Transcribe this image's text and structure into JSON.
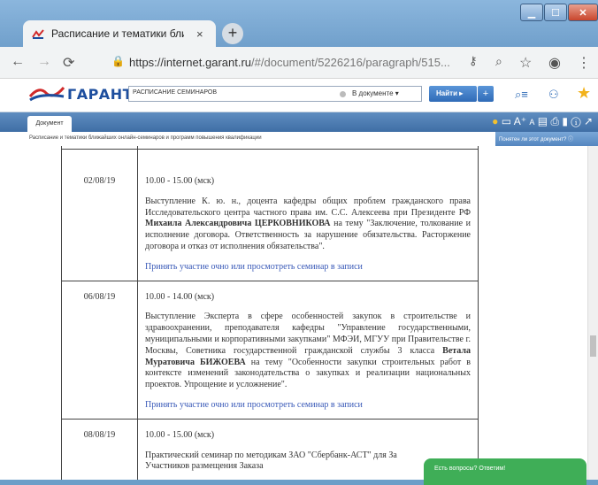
{
  "browser": {
    "tab_title": "Расписание и тематики ближай",
    "tab_close": "×",
    "new_tab": "+",
    "url_host": "https://internet.garant.ru",
    "url_path": "/#/document/5226216/paragraph/515...",
    "window_minimize": "▁",
    "window_maximize": "☐",
    "window_close": "✕"
  },
  "garant": {
    "logo_text": "ГАРАНТ",
    "search_value": "РАСПИСАНИЕ СЕМИНАРОВ",
    "scope": "В документе",
    "find_label": "Найти",
    "plus_label": "+",
    "doc_tab": "Документ"
  },
  "breadcrumb": "Расписание и тематики ближайших онлайн-семинаров и программ повышения квалификации",
  "help_text": "Понятен ли этот документ?",
  "schedule": [
    {
      "date": "02/08/19",
      "time": "10.00 - 15.00 (мск)",
      "desc_pre": "Выступление К. ю. н., доцента кафедры общих проблем гражданского права Исследовательского центра частного права им. С.С. Алексеева при Президенте РФ ",
      "desc_bold": "Михаила Александровича ЦЕРКОВНИКОВА",
      "desc_post": " на тему \"Заключение, толкование и исполнение договора. Ответственность за нарушение обязательства. Расторжение договора и отказ от исполнения обязательства\".",
      "link": "Принять участие очно или просмотреть семинар в записи"
    },
    {
      "date": "06/08/19",
      "time": "10.00 - 14.00 (мск)",
      "desc_pre": "Выступление Эксперта в сфере особенностей закупок в строительстве и здравоохранении, преподавателя кафедры \"Управление государственными, муниципальными и корпоративными закупками\" МФЭИ, МГУУ при Правительстве г. Москвы, Советника государственной гражданской службы 3 класса ",
      "desc_bold": "Ветала Муратовича БИЖОЕВА",
      "desc_post": " на тему \"Особенности закупки строительных работ в контексте изменений законодательства о закупках и реализации национальных проектов. Упрощение и усложнение\".",
      "link": "Принять участие очно или просмотреть семинар в записи"
    },
    {
      "date": "08/08/19",
      "time": "10.00 - 15.00 (мск)",
      "desc_pre": "Практический семинар по методикам ЗАО \"Сбербанк-АСТ\" для За",
      "desc_bold": "",
      "desc_post": "",
      "desc_line2": "Участников размещения Заказа",
      "link": ""
    }
  ],
  "chat_label": "Есть вопросы? Ответим!",
  "colors": {
    "accent": "#2f6bb7",
    "link": "#3a5ab8",
    "chat": "#3fae57"
  }
}
